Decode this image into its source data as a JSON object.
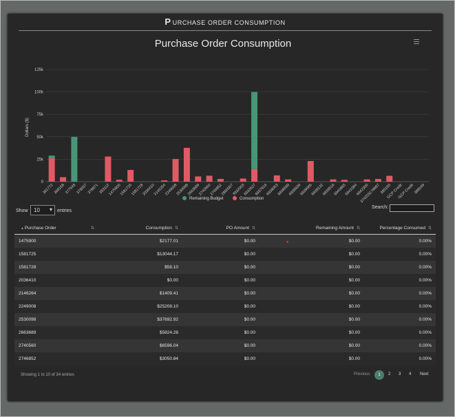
{
  "panel": {
    "title_big": "P",
    "title_rest": "URCHASE ORDER CONSUMPTION"
  },
  "colors": {
    "remaining": "#4a9578",
    "consumption": "#e05a66",
    "panel_bg": "#272727"
  },
  "chart_data": {
    "type": "bar",
    "stacked": true,
    "title": "Purchase Order Consumption",
    "ylabel": "Dollars ($)",
    "ylim": [
      0,
      125000
    ],
    "yticks": [
      "0",
      "25k",
      "50k",
      "75k",
      "100k",
      "125k"
    ],
    "ytick_values": [
      0,
      25000,
      50000,
      75000,
      100000,
      125000
    ],
    "grid": true,
    "legend_position": "bottom",
    "categories": [
      "361772",
      "368168",
      "377548",
      "378007",
      "378871",
      "393112",
      "1475900",
      "1581725",
      "1581728",
      "2036410",
      "2146264",
      "2249008",
      "2530098",
      "2663689",
      "2740560",
      "2746852",
      "2860007",
      "3932003",
      "6932627",
      "6937916",
      "6938053",
      "6938699",
      "6938939",
      "6939086",
      "6939132",
      "6939516",
      "6940865",
      "6941084",
      "6942300",
      "374203178987",
      "385165",
      "GCP Credit",
      "GCP Credit",
      "388049"
    ],
    "series": [
      {
        "name": "Remaining Budget",
        "values": [
          3000,
          0,
          50000,
          0,
          0,
          0,
          0,
          0,
          0,
          0,
          0,
          0,
          0,
          0,
          0,
          0,
          0,
          0,
          86000,
          0,
          0,
          0,
          0,
          0,
          0,
          0,
          0,
          0,
          0,
          0,
          0,
          0,
          0,
          0
        ]
      },
      {
        "name": "Consumption",
        "values": [
          26000,
          5000,
          0,
          0,
          0,
          28000,
          2177.01,
          13044.17,
          58.1,
          0,
          1409.41,
          25208.1,
          37692.92,
          5824.28,
          6596.04,
          3050.84,
          0,
          3500,
          14000,
          0,
          7000,
          2500,
          0,
          23000,
          0,
          2500,
          2000,
          0,
          2500,
          3000,
          6500,
          0,
          0,
          0
        ]
      }
    ]
  },
  "menu_icon": "hamburger-menu-icon",
  "table": {
    "show_label": "Show",
    "length_value": "10",
    "entries_label": "entries",
    "search_label": "Search:",
    "headers": [
      "Purchase Order",
      "Consumption",
      "PO Amount",
      "Remaining Amount",
      "Percentage Consumed"
    ],
    "rows": [
      [
        "1475900",
        "$2177.01",
        "$0.00",
        "$0.00",
        "0.00%"
      ],
      [
        "1581725",
        "$13044.17",
        "$0.00",
        "$0.00",
        "0.00%"
      ],
      [
        "1581728",
        "$58.10",
        "$0.00",
        "$0.00",
        "0.00%"
      ],
      [
        "2036410",
        "$0.00",
        "$0.00",
        "$0.00",
        "0.00%"
      ],
      [
        "2146264",
        "$1409.41",
        "$0.00",
        "$0.00",
        "0.00%"
      ],
      [
        "2249008",
        "$25208.10",
        "$0.00",
        "$0.00",
        "0.00%"
      ],
      [
        "2530098",
        "$37692.92",
        "$0.00",
        "$0.00",
        "0.00%"
      ],
      [
        "2663689",
        "$5824.28",
        "$0.00",
        "$0.00",
        "0.00%"
      ],
      [
        "2740560",
        "$6596.04",
        "$0.00",
        "$0.00",
        "0.00%"
      ],
      [
        "2746852",
        "$3050.84",
        "$0.00",
        "$0.00",
        "0.00%"
      ]
    ],
    "info": "Showing 1 to 10 of 34 entries",
    "pagination": {
      "previous": "Previous",
      "pages": [
        "1",
        "2",
        "3",
        "4"
      ],
      "next": "Next",
      "current": "1"
    }
  }
}
